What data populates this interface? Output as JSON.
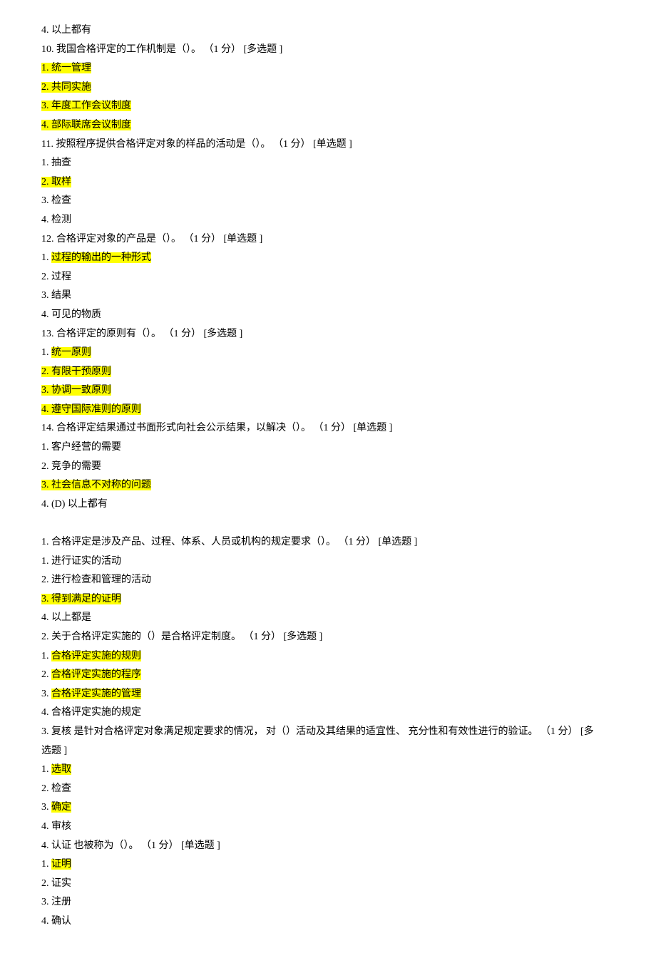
{
  "lines": [
    {
      "t": "plain",
      "segs": [
        [
          "4.  以上都有",
          false
        ]
      ]
    },
    {
      "t": "plain",
      "segs": [
        [
          "10.   我国合格评定的工作机制是（）。",
          false
        ],
        [
          "      （1 分）   [多选题 ]",
          false
        ]
      ]
    },
    {
      "t": "plain",
      "segs": [
        [
          "1.  统一管理",
          true
        ]
      ]
    },
    {
      "t": "plain",
      "segs": [
        [
          "2.  共同实施",
          true
        ]
      ]
    },
    {
      "t": "plain",
      "segs": [
        [
          "3.  年度工作会议制度",
          true
        ]
      ]
    },
    {
      "t": "plain",
      "segs": [
        [
          "4.  部际联席会议制度",
          true
        ]
      ]
    },
    {
      "t": "plain",
      "segs": [
        [
          "11.   按照程序提供合格评定对象的样品的活动是（）。",
          false
        ],
        [
          "         （1 分）   [单选题 ]",
          false
        ]
      ]
    },
    {
      "t": "plain",
      "segs": [
        [
          "1.  抽查",
          false
        ]
      ]
    },
    {
      "t": "plain",
      "segs": [
        [
          "2.  取样",
          true
        ]
      ]
    },
    {
      "t": "plain",
      "segs": [
        [
          "3.  检查",
          false
        ]
      ]
    },
    {
      "t": "plain",
      "segs": [
        [
          "4.  检测",
          false
        ]
      ]
    },
    {
      "t": "plain",
      "segs": [
        [
          "12.   合格评定对象的产品是（）。",
          false
        ],
        [
          "      （1 分）   [单选题 ]",
          false
        ]
      ]
    },
    {
      "t": "plain",
      "segs": [
        [
          "1.  ",
          false
        ],
        [
          "过程的输出的一种形式",
          true
        ]
      ]
    },
    {
      "t": "plain",
      "segs": [
        [
          "2.  过程",
          false
        ]
      ]
    },
    {
      "t": "plain",
      "segs": [
        [
          "3.  结果",
          false
        ]
      ]
    },
    {
      "t": "plain",
      "segs": [
        [
          "4.  可见的物质",
          false
        ]
      ]
    },
    {
      "t": "plain",
      "segs": [
        [
          "13.   合格评定的原则有（）。",
          false
        ],
        [
          "      （1 分）   [多选题 ]",
          false
        ]
      ]
    },
    {
      "t": "plain",
      "segs": [
        [
          "1.  ",
          false
        ],
        [
          "统一原则",
          true
        ]
      ]
    },
    {
      "t": "plain",
      "segs": [
        [
          "2.  有限干预原则",
          true
        ]
      ]
    },
    {
      "t": "plain",
      "segs": [
        [
          "3.  协调一致原则",
          true
        ]
      ]
    },
    {
      "t": "plain",
      "segs": [
        [
          "4.  遵守国际准则的原则",
          true
        ]
      ]
    },
    {
      "t": "plain",
      "segs": [
        [
          "14.   合格评定结果通过书面形式向社会公示结果，以解决（）。",
          false
        ],
        [
          "         （1 分）   [单选题 ]",
          false
        ]
      ]
    },
    {
      "t": "plain",
      "segs": [
        [
          "1.  客户经营的需要",
          false
        ]
      ]
    },
    {
      "t": "plain",
      "segs": [
        [
          "2.  竞争的需要",
          false
        ]
      ]
    },
    {
      "t": "plain",
      "segs": [
        [
          "3.  社会信息不对称的问题",
          true
        ]
      ]
    },
    {
      "t": "plain",
      "segs": [
        [
          "4. (D) 以上都有",
          false
        ]
      ]
    },
    {
      "t": "blank"
    },
    {
      "t": "plain",
      "segs": [
        [
          "1.  合格评定是涉及产品、过程、体系、人员或机构的规定要求（）。",
          false
        ],
        [
          "         （1 分）   [单选题 ]",
          false
        ]
      ]
    },
    {
      "t": "plain",
      "segs": [
        [
          "1.  进行证实的活动",
          false
        ]
      ]
    },
    {
      "t": "plain",
      "segs": [
        [
          "2.  进行检查和管理的活动",
          false
        ]
      ]
    },
    {
      "t": "plain",
      "segs": [
        [
          "3.  得到满足的证明",
          true
        ]
      ]
    },
    {
      "t": "plain",
      "segs": [
        [
          "4.  以上都是",
          false
        ]
      ]
    },
    {
      "t": "plain",
      "segs": [
        [
          "2.  关于合格评定实施的（）是合格评定制度。",
          false
        ],
        [
          "      （1 分）   [多选题 ]",
          false
        ]
      ]
    },
    {
      "t": "plain",
      "segs": [
        [
          "1.  ",
          false
        ],
        [
          "合格评定实施的规则",
          true
        ]
      ]
    },
    {
      "t": "plain",
      "segs": [
        [
          "2.  ",
          false
        ],
        [
          "合格评定实施的程序",
          true
        ]
      ]
    },
    {
      "t": "plain",
      "segs": [
        [
          "3.  ",
          false
        ],
        [
          "合格评定实施的管理",
          true
        ]
      ]
    },
    {
      "t": "plain",
      "segs": [
        [
          "4.  合格评定实施的规定",
          false
        ]
      ]
    },
    {
      "t": "plain",
      "segs": [
        [
          "3.  复核 是针对合格评定对象满足规定要求的情况，      对（）活动及其结果的适宜性、   充分性和有效性进行的验证。      （1 分）   [多",
          false
        ]
      ]
    },
    {
      "t": "plain",
      "lead": true,
      "segs": [
        [
          "选题 ]",
          false
        ]
      ]
    },
    {
      "t": "plain",
      "segs": [
        [
          "1.  ",
          false
        ],
        [
          "选取",
          true
        ]
      ]
    },
    {
      "t": "plain",
      "segs": [
        [
          "2.  检查",
          false
        ]
      ]
    },
    {
      "t": "plain",
      "segs": [
        [
          "3.  ",
          false
        ],
        [
          "确定",
          true
        ]
      ]
    },
    {
      "t": "plain",
      "segs": [
        [
          "4.  审核",
          false
        ]
      ]
    },
    {
      "t": "plain",
      "segs": [
        [
          "4.  认证 也被称为（）。",
          false
        ],
        [
          "      （1 分）   [单选题 ]",
          false
        ]
      ]
    },
    {
      "t": "plain",
      "segs": [
        [
          "1.  ",
          false
        ],
        [
          "证明",
          true
        ]
      ]
    },
    {
      "t": "plain",
      "segs": [
        [
          "2.  证实",
          false
        ]
      ]
    },
    {
      "t": "plain",
      "segs": [
        [
          "3.  注册",
          false
        ]
      ]
    },
    {
      "t": "plain",
      "segs": [
        [
          "4.  确认",
          false
        ]
      ]
    }
  ]
}
